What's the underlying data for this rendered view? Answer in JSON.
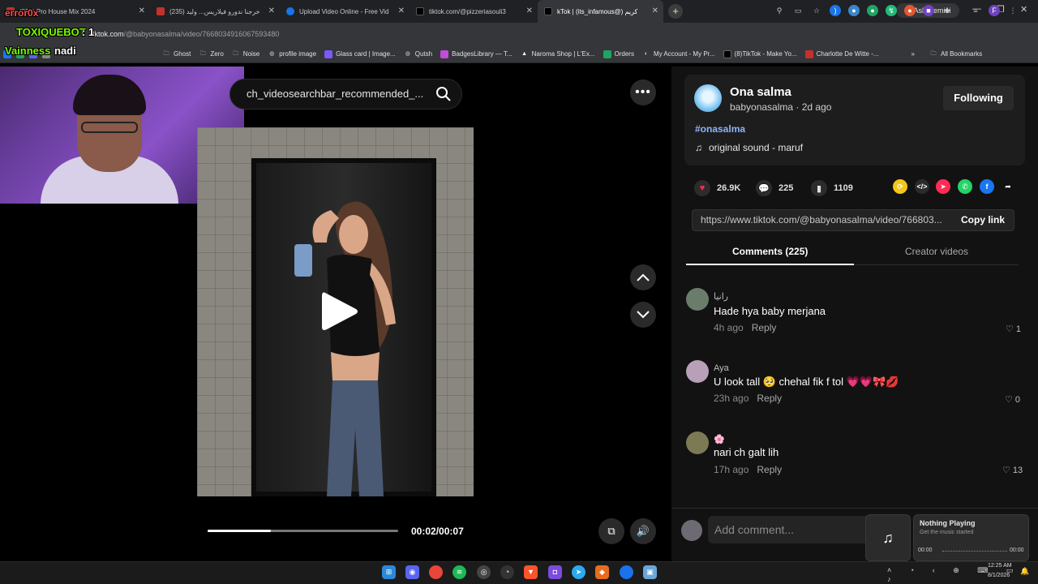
{
  "browser": {
    "tabs": [
      {
        "label": "(335) Pro House Mix 2024",
        "color": "#c4302b"
      },
      {
        "label": "(235) خرجنا ندورو فيلاريس... وليد",
        "color": "#c4302b"
      },
      {
        "label": "Upload Video Online - Free Vid",
        "color": "#1a73e8"
      },
      {
        "label": "tiktok.com/@pizzeriasouli3",
        "color": "#111111"
      },
      {
        "label": "kTok | (its_infamous@) كريم",
        "color": "#111111"
      }
    ],
    "ask_gemini": "Ask Gemini",
    "url_domain": "tiktok.com",
    "url_path": "/@babyonasalma/video/7668034916067593480",
    "bookmarks": [
      "Ghost",
      "Zero",
      "Noise",
      "profile image",
      "Glass card | Image...",
      "Qutsh",
      "BadgesLibrary — T...",
      "Naroma Shop | L'Ex...",
      "Orders",
      "My Account - My Pr...",
      "(8)TikTok - Make Yo...",
      "Charlotte De Witte -..."
    ],
    "all_bookmarks": "All Bookmarks"
  },
  "overlay": {
    "error_name": "error0x",
    "bot_name": "TOXIQUEBOT",
    "bot_count": ": 1",
    "vainness": "Vainness",
    "nadi": "nadi"
  },
  "search": {
    "text": "ch_videosearchbar_recommended_..."
  },
  "player": {
    "current": "00:02",
    "total": "00:07",
    "progress": 0.33
  },
  "author": {
    "name": "Ona salma",
    "handle": "babyonasalma",
    "age": "2d ago",
    "follow_label": "Following",
    "hashtag": "#onasalma",
    "sound": "original sound - maruf"
  },
  "stats": {
    "likes": "26.9K",
    "comments": "225",
    "saves": "1109"
  },
  "share": {
    "link": "https://www.tiktok.com/@babyonasalma/video/766803...",
    "copy_label": "Copy link",
    "icons": [
      {
        "name": "repost-icon",
        "color": "#f5c518",
        "glyph": "⟳"
      },
      {
        "name": "embed-icon",
        "color": "#2b2b2b",
        "glyph": "</>"
      },
      {
        "name": "send-icon",
        "color": "#fe2c55",
        "glyph": "➤"
      },
      {
        "name": "whatsapp-icon",
        "color": "#25d366",
        "glyph": "✆"
      },
      {
        "name": "facebook-icon",
        "color": "#1877f2",
        "glyph": "f"
      },
      {
        "name": "share-arrow-icon",
        "color": "#121212",
        "glyph": "➦"
      }
    ]
  },
  "tabs": {
    "comments": "Comments (225)",
    "creator": "Creator videos"
  },
  "comments": [
    {
      "user": "رانيا",
      "text": "Hade hya baby merjana",
      "time": "4h ago",
      "likes": "1",
      "avatar": "#6a7d6a"
    },
    {
      "user": "Aya",
      "text": "U look tall 🥺 chehal fik f tol 💗💗🎀💋",
      "time": "23h ago",
      "likes": "0",
      "avatar": "#b7a0b8"
    },
    {
      "user": "🌸",
      "text": "nari ch galt lih",
      "time": "17h ago",
      "likes": "13",
      "avatar": "#7c7a55"
    }
  ],
  "reply_label": "Reply",
  "add_comment_placeholder": "Add comment...",
  "media_flyout": {
    "title": "Nothing Playing",
    "subtitle": "Get the music started",
    "start": "00:00",
    "end": "00:00"
  },
  "clock": {
    "time": "12:25 AM",
    "date": "8/1/2026"
  }
}
